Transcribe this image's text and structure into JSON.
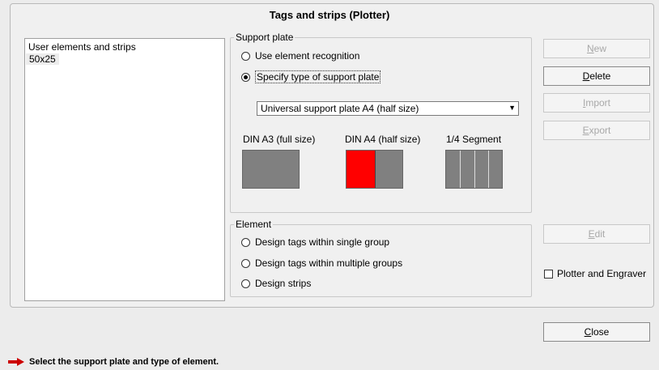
{
  "window": {
    "title": "Tags and strips (Plotter)"
  },
  "user_elements": {
    "header": "User elements and strips",
    "items": [
      "50x25"
    ]
  },
  "support_plate": {
    "legend": "Support plate",
    "options": [
      "Use element recognition",
      "Specify type of support plate"
    ],
    "selected_option": "Specify type of support plate",
    "plate_dropdown_value": "Universal support plate A4 (half size)",
    "plate_types": [
      "DIN A3 (full size)",
      "DIN A4 (half size)",
      "1/4 Segment"
    ],
    "colors": {
      "plate_gray": "#808080",
      "highlight_red": "#ff0000"
    }
  },
  "element": {
    "legend": "Element",
    "options": [
      "Design tags within single group",
      "Design tags within multiple groups",
      "Design strips"
    ]
  },
  "buttons": {
    "new": {
      "accel": "N",
      "rest": "ew",
      "enabled": false
    },
    "delete": {
      "accel": "D",
      "rest": "elete",
      "enabled": true
    },
    "import": {
      "accel": "I",
      "rest": "mport",
      "enabled": false
    },
    "export": {
      "accel": "E",
      "rest": "xport",
      "enabled": false
    },
    "edit": {
      "accel": "E",
      "rest": "dit",
      "enabled": false
    },
    "close": {
      "accel": "C",
      "rest": "lose",
      "enabled": true
    }
  },
  "plotter_engraver": {
    "label": "Plotter and Engraver",
    "checked": false
  },
  "status": {
    "message": "Select the support plate and type of element.",
    "arrow_color": "#cc0000"
  }
}
